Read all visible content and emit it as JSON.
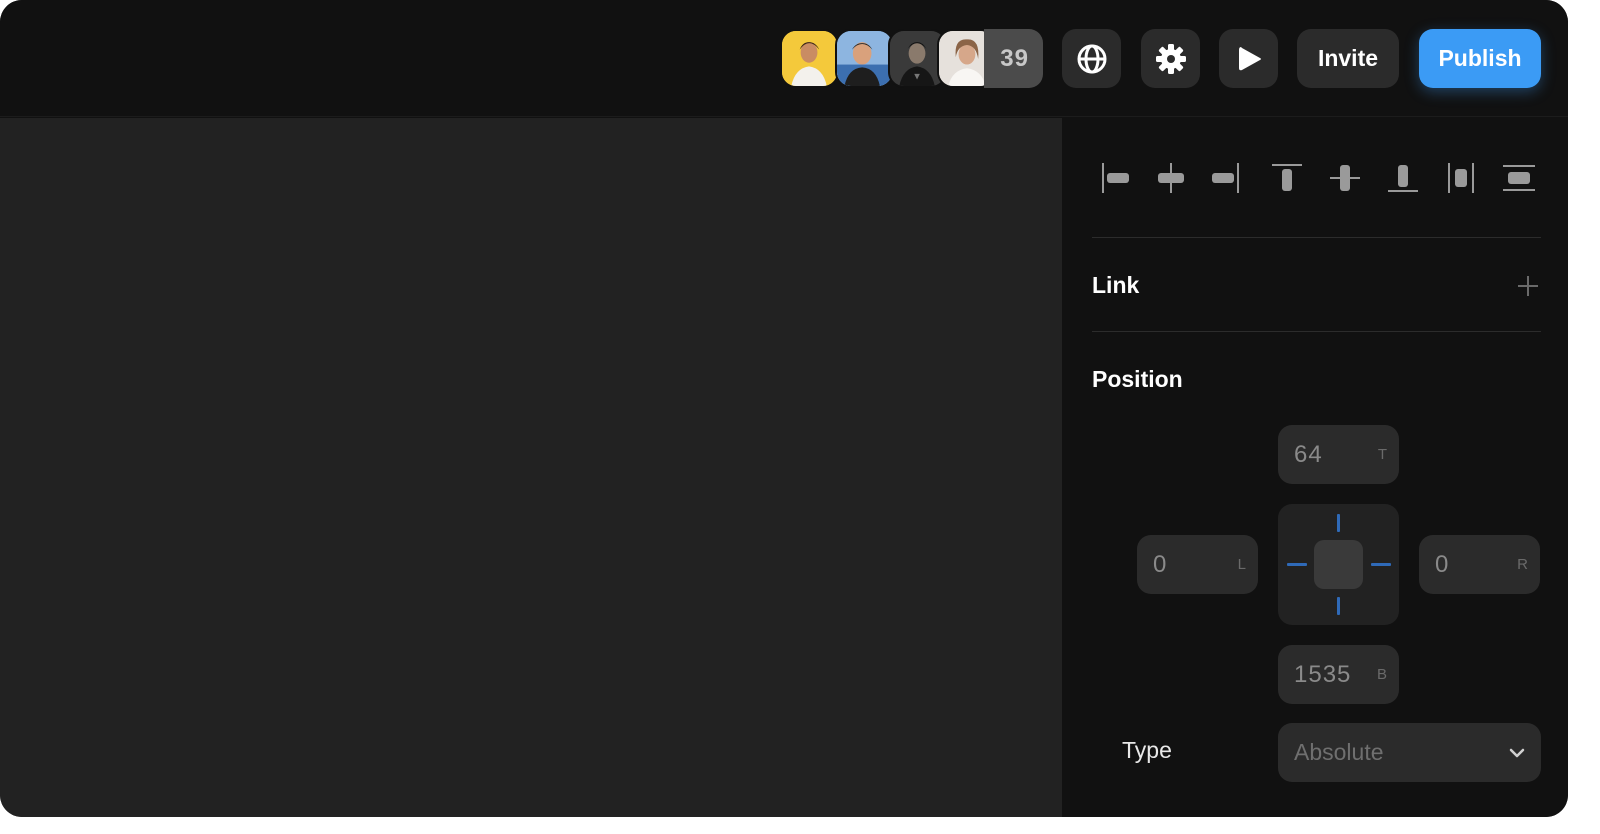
{
  "toolbar": {
    "avatars": [
      {
        "name": "avatar-1",
        "bg": "#f4c93b"
      },
      {
        "name": "avatar-2",
        "bg": "#6fa0d8"
      },
      {
        "name": "avatar-3",
        "bg": "#2a2a2a"
      },
      {
        "name": "avatar-4",
        "bg": "#d8d2cc"
      }
    ],
    "collaborator_count": "39",
    "icons": [
      "globe-icon",
      "gear-icon",
      "play-icon"
    ],
    "invite_label": "Invite",
    "publish_label": "Publish",
    "accent": "#3b9bf5"
  },
  "panel": {
    "align_tools": [
      "align-left",
      "align-horizontal-center",
      "align-right",
      "align-top",
      "align-vertical-center",
      "align-bottom",
      "distribute-horizontal",
      "distribute-vertical"
    ],
    "link": {
      "title": "Link",
      "add_icon": "plus-icon"
    },
    "position": {
      "title": "Position",
      "top": {
        "value": "64",
        "suffix": "T"
      },
      "left": {
        "value": "0",
        "suffix": "L"
      },
      "right": {
        "value": "0",
        "suffix": "R"
      },
      "bottom": {
        "value": "1535",
        "suffix": "B"
      },
      "type_label": "Type",
      "type_value": "Absolute"
    }
  }
}
